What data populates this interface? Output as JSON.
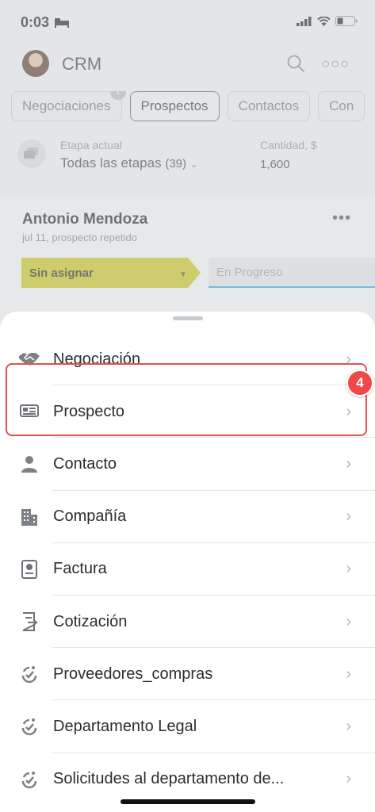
{
  "status": {
    "time": "0:03"
  },
  "header": {
    "title": "CRM"
  },
  "tabs": [
    {
      "label": "Negociaciones",
      "badge": "1"
    },
    {
      "label": "Prospectos"
    },
    {
      "label": "Contactos"
    },
    {
      "label": "Con"
    }
  ],
  "stage": {
    "label": "Etapa actual",
    "value": "Todas las etapas",
    "count": "(39)",
    "amount_label": "Cantidad, $",
    "amount_value": "1,600"
  },
  "card": {
    "name": "Antonio Mendoza",
    "subtitle": "jul 11, prospecto repetido",
    "stage_chip": "Sin asignar",
    "progress_placeholder": "En Progreso"
  },
  "sheet": {
    "items": [
      {
        "label": "Negociación",
        "icon": "handshake-icon"
      },
      {
        "label": "Prospecto",
        "icon": "id-card-icon"
      },
      {
        "label": "Contacto",
        "icon": "person-icon"
      },
      {
        "label": "Compañía",
        "icon": "building-icon"
      },
      {
        "label": "Factura",
        "icon": "invoice-icon"
      },
      {
        "label": "Cotización",
        "icon": "quote-icon"
      },
      {
        "label": "Proveedores_compras",
        "icon": "process-icon"
      },
      {
        "label": "Departamento Legal",
        "icon": "process-icon"
      },
      {
        "label": "Solicitudes al departamento de...",
        "icon": "process-icon"
      }
    ]
  },
  "annotation": {
    "step": "4",
    "color": "#e4504f"
  },
  "colors": {
    "stage_chip": "#c9c617",
    "progress_underline": "#3ba3d8"
  }
}
